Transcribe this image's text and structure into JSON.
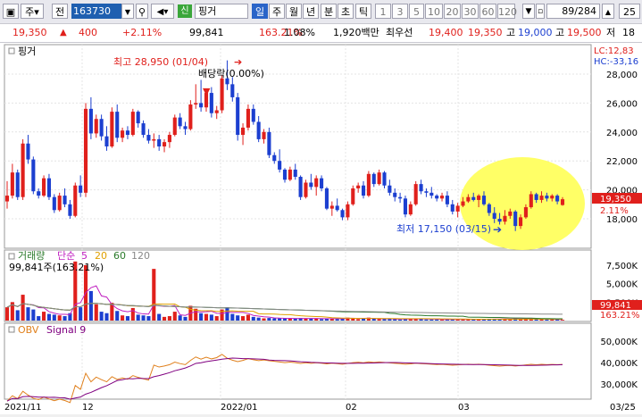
{
  "toolbar": {
    "tab_char": "주",
    "prev_label": "전",
    "code": "163730",
    "market_badge": "신",
    "name": "핑거",
    "periods": [
      "일",
      "주",
      "월",
      "년",
      "분",
      "초",
      "틱"
    ],
    "active_period": "일",
    "intervals": [
      "1",
      "3",
      "5",
      "10",
      "20",
      "30",
      "60",
      "120"
    ],
    "counter": "89/284",
    "date_badge": "25"
  },
  "infobar": {
    "price": "19,350",
    "change": "400",
    "change_pct": "+2.11%",
    "volume": "99,841",
    "vol_ratio": "163.21%",
    "turnover": "1.08%",
    "amount": "1,920백만",
    "best_label": "최우선",
    "ask": "19,400",
    "bid": "19,350",
    "high_label": "고",
    "high": "19,000",
    "low_label": "고",
    "low": "19,500",
    "prev_label": "저",
    "prev": "18"
  },
  "price_panel": {
    "name_label": "핑거",
    "high_annot": "최고 28,950 (01/04)",
    "dividend_annot": "배당락(0.00%)",
    "low_annot": "최저 17,150 (03/15)",
    "lc": "LC:12,83",
    "hc": "HC:-33,16",
    "price_tag": "19,350",
    "pct_tag": "2.11%",
    "yticks": [
      "28,000",
      "26,000",
      "24,000",
      "22,000",
      "20,000",
      "18,000"
    ]
  },
  "volume_panel": {
    "title": "거래량",
    "ma_label": "단순",
    "ma_periods": [
      "5",
      "20",
      "60",
      "120"
    ],
    "current": "99,841주(163.21%)",
    "tag_value": "99,841",
    "tag_pct": "163.21%",
    "yticks": [
      "7,500K",
      "5,000K",
      "2,500K"
    ]
  },
  "obv_panel": {
    "title": "OBV",
    "signal": "Signal 9",
    "yticks": [
      "50,000K",
      "40,000K",
      "30,000K"
    ]
  },
  "xaxis": [
    "2021/11",
    "12",
    "2022/01",
    "02",
    "03",
    "03/25"
  ],
  "colors": {
    "up": "#e0201c",
    "down": "#1c3fd0",
    "highlight": "#ffff66",
    "toolbar": "#e8e8ee"
  },
  "chart_data": {
    "type": "candlestick",
    "series_volume_unit": "K shares",
    "candles": [
      [
        19200,
        20600,
        18700,
        19600,
        1800
      ],
      [
        19600,
        21800,
        19400,
        21200,
        2500
      ],
      [
        21200,
        21400,
        19300,
        19500,
        1400
      ],
      [
        19500,
        23500,
        19300,
        23200,
        3500
      ],
      [
        23200,
        23800,
        21800,
        22100,
        1800
      ],
      [
        22100,
        22300,
        19700,
        19900,
        1500
      ],
      [
        19900,
        20100,
        19400,
        19600,
        600
      ],
      [
        19600,
        21000,
        19500,
        20800,
        1200
      ],
      [
        20800,
        21100,
        19300,
        19500,
        900
      ],
      [
        19500,
        19700,
        18400,
        18600,
        800
      ],
      [
        18600,
        19800,
        18500,
        19600,
        700
      ],
      [
        19600,
        20100,
        18800,
        19000,
        600
      ],
      [
        19000,
        19300,
        18000,
        18200,
        1000
      ],
      [
        18200,
        20500,
        18100,
        20300,
        8000
      ],
      [
        20300,
        21000,
        19500,
        19800,
        1800
      ],
      [
        19800,
        26000,
        19500,
        25600,
        7500
      ],
      [
        25600,
        26400,
        23500,
        23900,
        4000
      ],
      [
        23900,
        25200,
        23600,
        24900,
        2200
      ],
      [
        24900,
        25200,
        23400,
        23700,
        1200
      ],
      [
        23700,
        24400,
        22700,
        23000,
        1000
      ],
      [
        23000,
        25700,
        22900,
        25400,
        2400
      ],
      [
        25400,
        25900,
        23300,
        23600,
        1300
      ],
      [
        23600,
        24300,
        23300,
        24100,
        700
      ],
      [
        24100,
        24400,
        23500,
        23800,
        600
      ],
      [
        23800,
        25600,
        23700,
        25400,
        1700
      ],
      [
        25400,
        25500,
        24300,
        24600,
        800
      ],
      [
        24600,
        24800,
        23600,
        23800,
        700
      ],
      [
        23800,
        24200,
        23200,
        23400,
        600
      ],
      [
        23400,
        23900,
        22900,
        23500,
        7000
      ],
      [
        23500,
        23800,
        22700,
        23000,
        900
      ],
      [
        23000,
        23500,
        22600,
        23300,
        500
      ],
      [
        23300,
        24000,
        22900,
        23800,
        600
      ],
      [
        23800,
        25200,
        23700,
        25000,
        1200
      ],
      [
        25000,
        25300,
        24200,
        24400,
        700
      ],
      [
        24400,
        24700,
        23800,
        24200,
        500
      ],
      [
        24200,
        26200,
        24100,
        25900,
        2000
      ],
      [
        25900,
        27300,
        25600,
        26000,
        1600
      ],
      [
        26000,
        27600,
        25400,
        25700,
        1000
      ],
      [
        25700,
        26900,
        25400,
        26700,
        900
      ],
      [
        26700,
        27100,
        25000,
        25300,
        800
      ],
      [
        25300,
        25800,
        24900,
        25500,
        600
      ],
      [
        25500,
        27900,
        25300,
        27700,
        1500
      ],
      [
        27700,
        28950,
        26900,
        27300,
        1800
      ],
      [
        27300,
        27800,
        26100,
        26400,
        900
      ],
      [
        26400,
        26700,
        23400,
        23800,
        700
      ],
      [
        23800,
        24600,
        23100,
        24300,
        600
      ],
      [
        24300,
        25900,
        24100,
        25600,
        800
      ],
      [
        25600,
        25900,
        24500,
        24700,
        500
      ],
      [
        24700,
        25100,
        23300,
        23500,
        400
      ],
      [
        23500,
        24200,
        23200,
        24000,
        300
      ],
      [
        24000,
        24300,
        22200,
        22400,
        350
      ],
      [
        22400,
        22600,
        21800,
        22000,
        300
      ],
      [
        22000,
        22800,
        21200,
        21400,
        300
      ],
      [
        21400,
        21500,
        20500,
        20700,
        300
      ],
      [
        20700,
        21600,
        20600,
        21400,
        250
      ],
      [
        21400,
        21800,
        20700,
        20900,
        250
      ],
      [
        20900,
        21000,
        19300,
        19500,
        350
      ],
      [
        19500,
        20700,
        19400,
        20500,
        300
      ],
      [
        20500,
        21100,
        20000,
        20200,
        250
      ],
      [
        20200,
        21000,
        19600,
        20800,
        250
      ],
      [
        20800,
        21000,
        19900,
        20100,
        200
      ],
      [
        20100,
        20200,
        18600,
        18700,
        300
      ],
      [
        18700,
        19200,
        18200,
        18900,
        300
      ],
      [
        18900,
        19400,
        18500,
        18600,
        200
      ],
      [
        18600,
        18700,
        17900,
        18100,
        300
      ],
      [
        18100,
        19200,
        17900,
        19000,
        400
      ],
      [
        19000,
        20300,
        18900,
        20100,
        350
      ],
      [
        20100,
        20500,
        19800,
        20300,
        200
      ],
      [
        20300,
        20600,
        19400,
        19600,
        250
      ],
      [
        19600,
        21300,
        19500,
        21100,
        400
      ],
      [
        21100,
        21200,
        20200,
        20400,
        250
      ],
      [
        20400,
        21400,
        20300,
        21200,
        200
      ],
      [
        21200,
        21300,
        20100,
        20300,
        200
      ],
      [
        20300,
        20700,
        19600,
        19800,
        200
      ],
      [
        19800,
        20100,
        19200,
        19500,
        200
      ],
      [
        19500,
        19800,
        19100,
        19400,
        150
      ],
      [
        19400,
        19600,
        18100,
        18300,
        300
      ],
      [
        18300,
        19200,
        18200,
        19000,
        200
      ],
      [
        19000,
        20600,
        18900,
        20400,
        300
      ],
      [
        20400,
        20700,
        19700,
        19900,
        200
      ],
      [
        19900,
        20100,
        19500,
        19800,
        150
      ],
      [
        19800,
        20200,
        19400,
        19600,
        150
      ],
      [
        19600,
        19700,
        19200,
        19400,
        150
      ],
      [
        19400,
        19800,
        19200,
        19600,
        120
      ],
      [
        19600,
        19900,
        18800,
        19000,
        200
      ],
      [
        19000,
        19300,
        18300,
        18500,
        200
      ],
      [
        18500,
        19100,
        18100,
        18900,
        150
      ],
      [
        18900,
        19500,
        18800,
        19200,
        150
      ],
      [
        19200,
        19700,
        19100,
        19500,
        150
      ],
      [
        19500,
        19800,
        19200,
        19300,
        150
      ],
      [
        19300,
        19700,
        18800,
        19600,
        150
      ],
      [
        19600,
        19900,
        18900,
        19000,
        200
      ],
      [
        19000,
        19100,
        18200,
        18400,
        250
      ],
      [
        18400,
        18800,
        17700,
        18000,
        250
      ],
      [
        18000,
        18400,
        17600,
        17800,
        200
      ],
      [
        17800,
        18600,
        17600,
        18200,
        200
      ],
      [
        18200,
        18700,
        18000,
        18500,
        150
      ],
      [
        18500,
        18600,
        17150,
        17500,
        300
      ],
      [
        17500,
        18300,
        17300,
        18100,
        250
      ],
      [
        18100,
        19000,
        18000,
        18800,
        300
      ],
      [
        18800,
        19900,
        18700,
        19700,
        250
      ],
      [
        19700,
        19800,
        19100,
        19300,
        200
      ],
      [
        19300,
        19900,
        19100,
        19600,
        200
      ],
      [
        19600,
        19800,
        19200,
        19400,
        150
      ],
      [
        19400,
        19700,
        19200,
        19600,
        120
      ],
      [
        19600,
        19700,
        19000,
        19200,
        150
      ],
      [
        18950,
        19500,
        18900,
        19350,
        100
      ]
    ]
  }
}
